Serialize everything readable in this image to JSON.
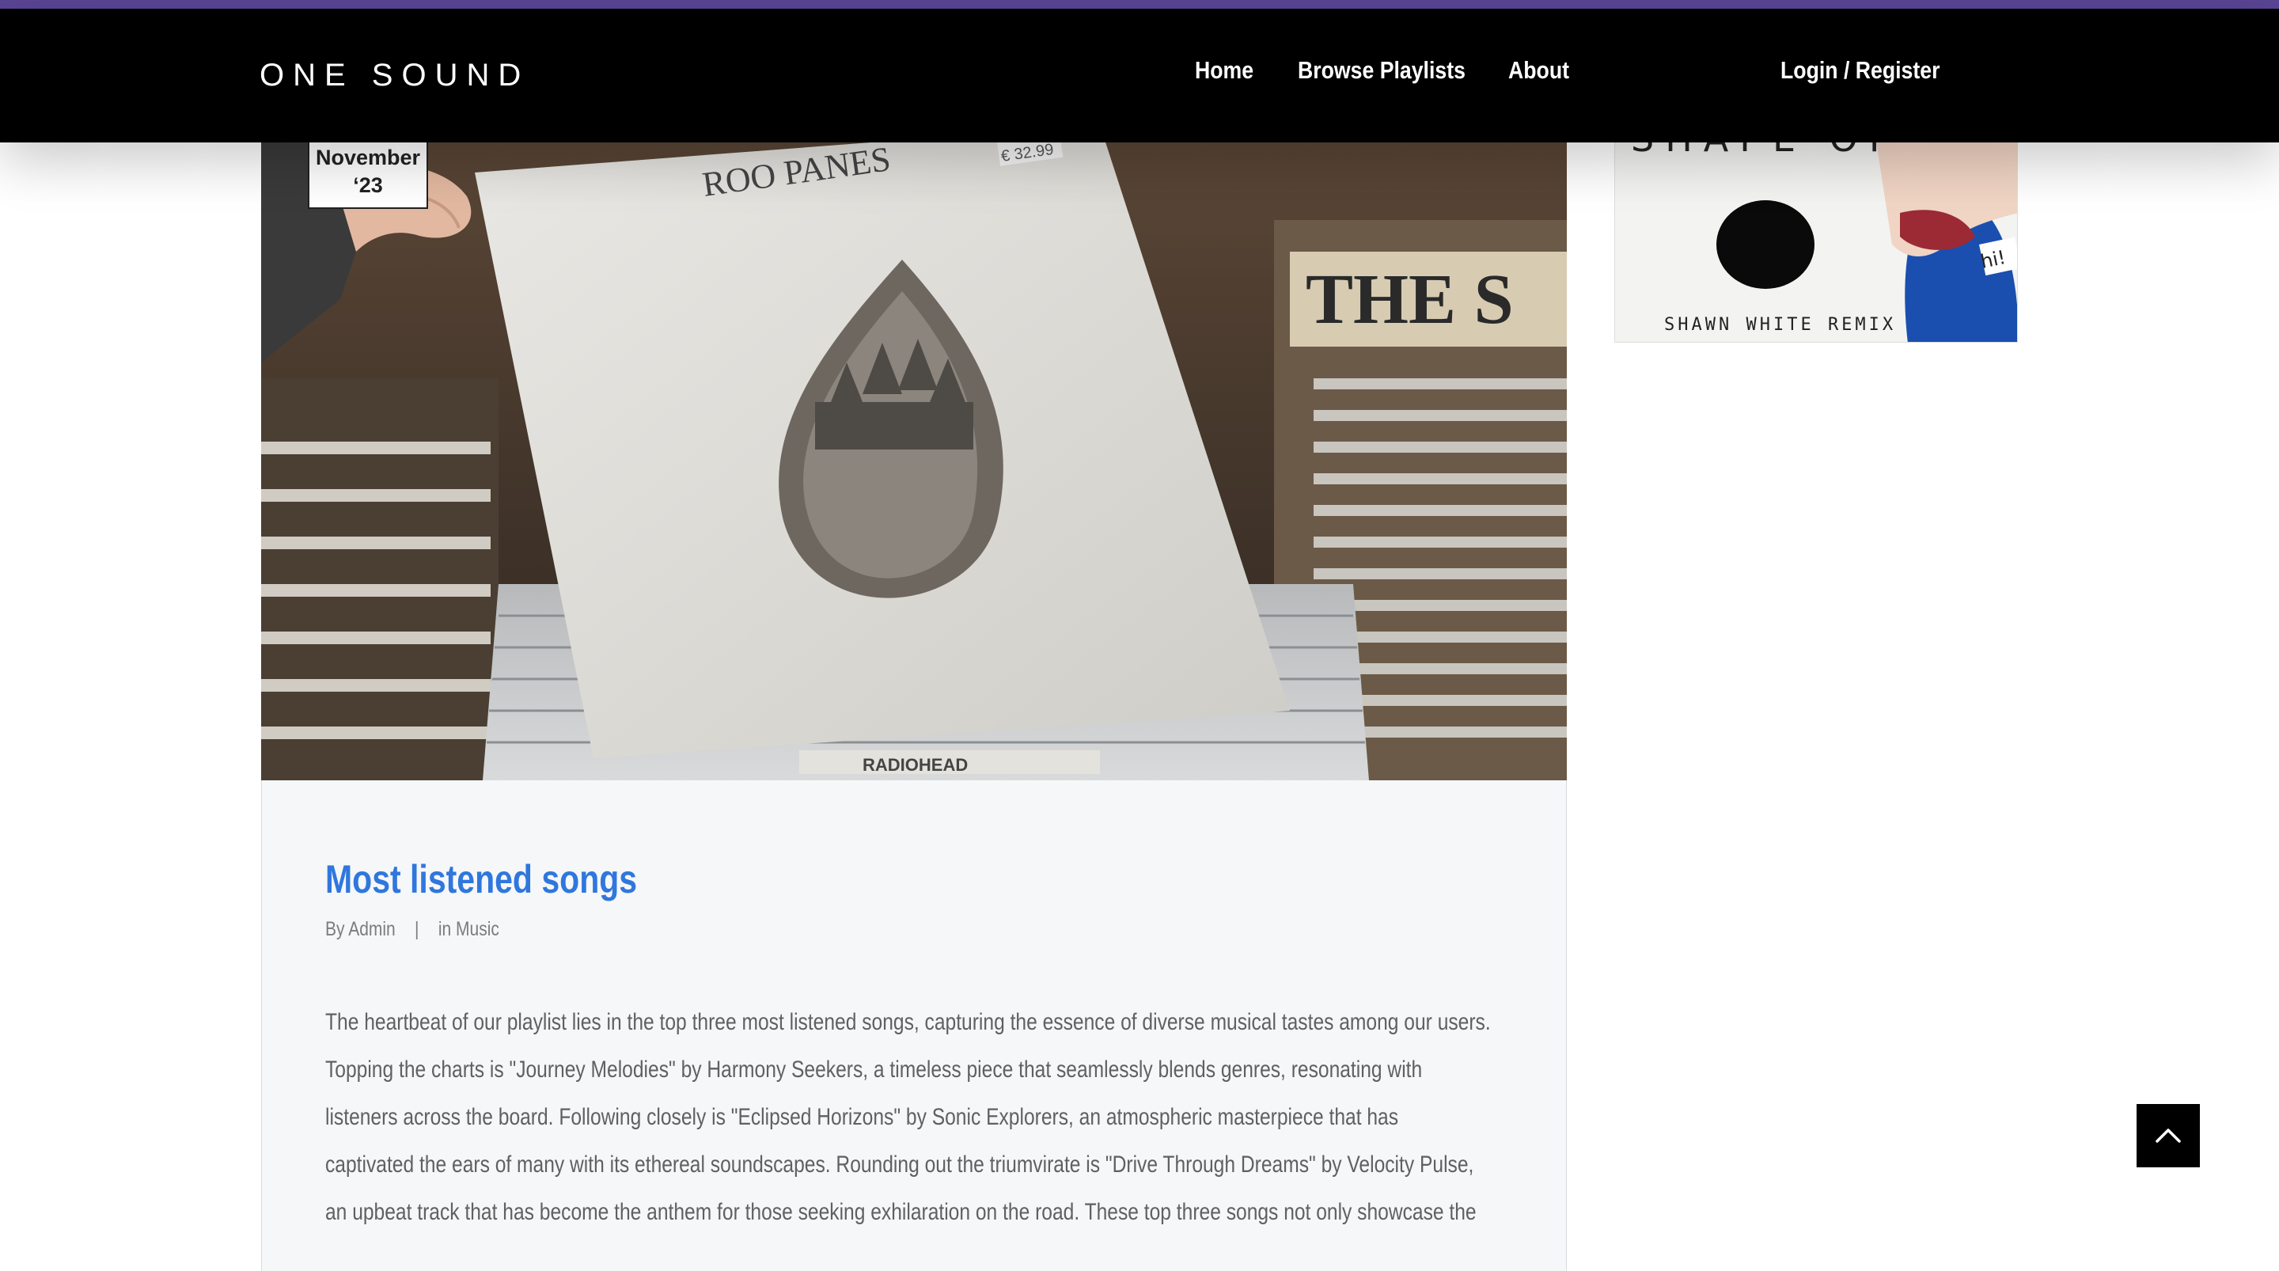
{
  "header": {
    "logo": "ONE SOUND",
    "nav": [
      {
        "label": "Home"
      },
      {
        "label": "Browse Playlists"
      },
      {
        "label": "About"
      }
    ],
    "login_label": "Login / Register",
    "accent_color": "#5b4596",
    "background_color": "#000000"
  },
  "post": {
    "date_month": "November",
    "date_year": "‘23",
    "image_text": {
      "sleeve": "ROO PANES",
      "price": "€ 32.99",
      "divider": "RADIOHEAD",
      "box": "THE S"
    },
    "title": "Most listened songs",
    "author_prefix": "By",
    "author": "Admin",
    "separator": "|",
    "category_prefix": "in",
    "category": "Music",
    "body_lines": [
      "The heartbeat of our playlist lies in the top three most listened songs, capturing the essence of diverse musical tastes among our users.",
      "Topping the charts is \"Journey Melodies\" by Harmony Seekers, a timeless piece that seamlessly blends genres, resonating with",
      "listeners across the board. Following closely is \"Eclipsed Horizons\" by Sonic Explorers, an atmospheric masterpiece that has",
      "captivated the ears of many with its ethereal soundscapes. Rounding out the triumvirate is \"Drive Through Dreams\" by Velocity Pulse,",
      "an upbeat track that has become the anthem for those seeking exhilaration on the road. These top three songs not only showcase the"
    ],
    "title_color": "#2f77de"
  },
  "sidebar": {
    "cover_title": "SHAPE OF YOU",
    "cover_subtitle": "SHAWN WHITE REMIX",
    "cover_sticker": "hi!"
  },
  "back_to_top": {
    "icon": "chevron-up-icon"
  }
}
